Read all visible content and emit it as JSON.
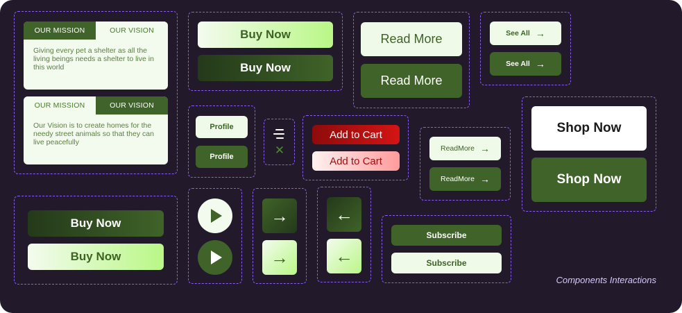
{
  "tab_card_1": {
    "tab_mission": "OUR MISSION",
    "tab_vision": "OUR VISION",
    "active": "mission",
    "text": "Giving every pet a shelter as all the living beings needs a shelter to live in this world"
  },
  "tab_card_2": {
    "tab_mission": "OUR MISSION",
    "tab_vision": "OUR VISION",
    "active": "vision",
    "text": "Our Vision is to create homes for the needy street animals so that they can live peacefully"
  },
  "buy_now_top": {
    "light_label": "Buy Now",
    "dark_label": "Buy Now"
  },
  "read_more_large": {
    "light_label": "Read More",
    "dark_label": "Read More"
  },
  "see_all": {
    "light_label": "See All",
    "dark_label": "See All",
    "arrow": "→"
  },
  "profile": {
    "light_label": "Profile",
    "dark_label": "Profile"
  },
  "menu_toggle": {
    "menu_icon": "menu-icon",
    "close_icon": "close-icon",
    "close_glyph": "✕"
  },
  "add_to_cart": {
    "primary_label": "Add to Cart",
    "secondary_label": "Add to Cart"
  },
  "read_more_small": {
    "light_label": "ReadMore",
    "dark_label": "ReadMore",
    "arrow": "→"
  },
  "shop_now": {
    "light_label": "Shop Now",
    "dark_label": "Shop Now"
  },
  "buy_now_bottom": {
    "dark_label": "Buy Now",
    "light_label": "Buy Now"
  },
  "play": {
    "icon": "play-icon"
  },
  "arrows": {
    "right_glyph": "→",
    "left_glyph": "←"
  },
  "subscribe": {
    "dark_label": "Subscribe",
    "light_label": "Subscribe"
  },
  "caption": "Components Interactions",
  "colors": {
    "background": "#221a2b",
    "dash": "#8b5cf6",
    "brand_dark": "#3f6328",
    "brand_light": "#f0fae8",
    "accent_green": "#b9f786",
    "cart_red": "#c40c0c",
    "cart_pink": "#ffc2c2"
  }
}
